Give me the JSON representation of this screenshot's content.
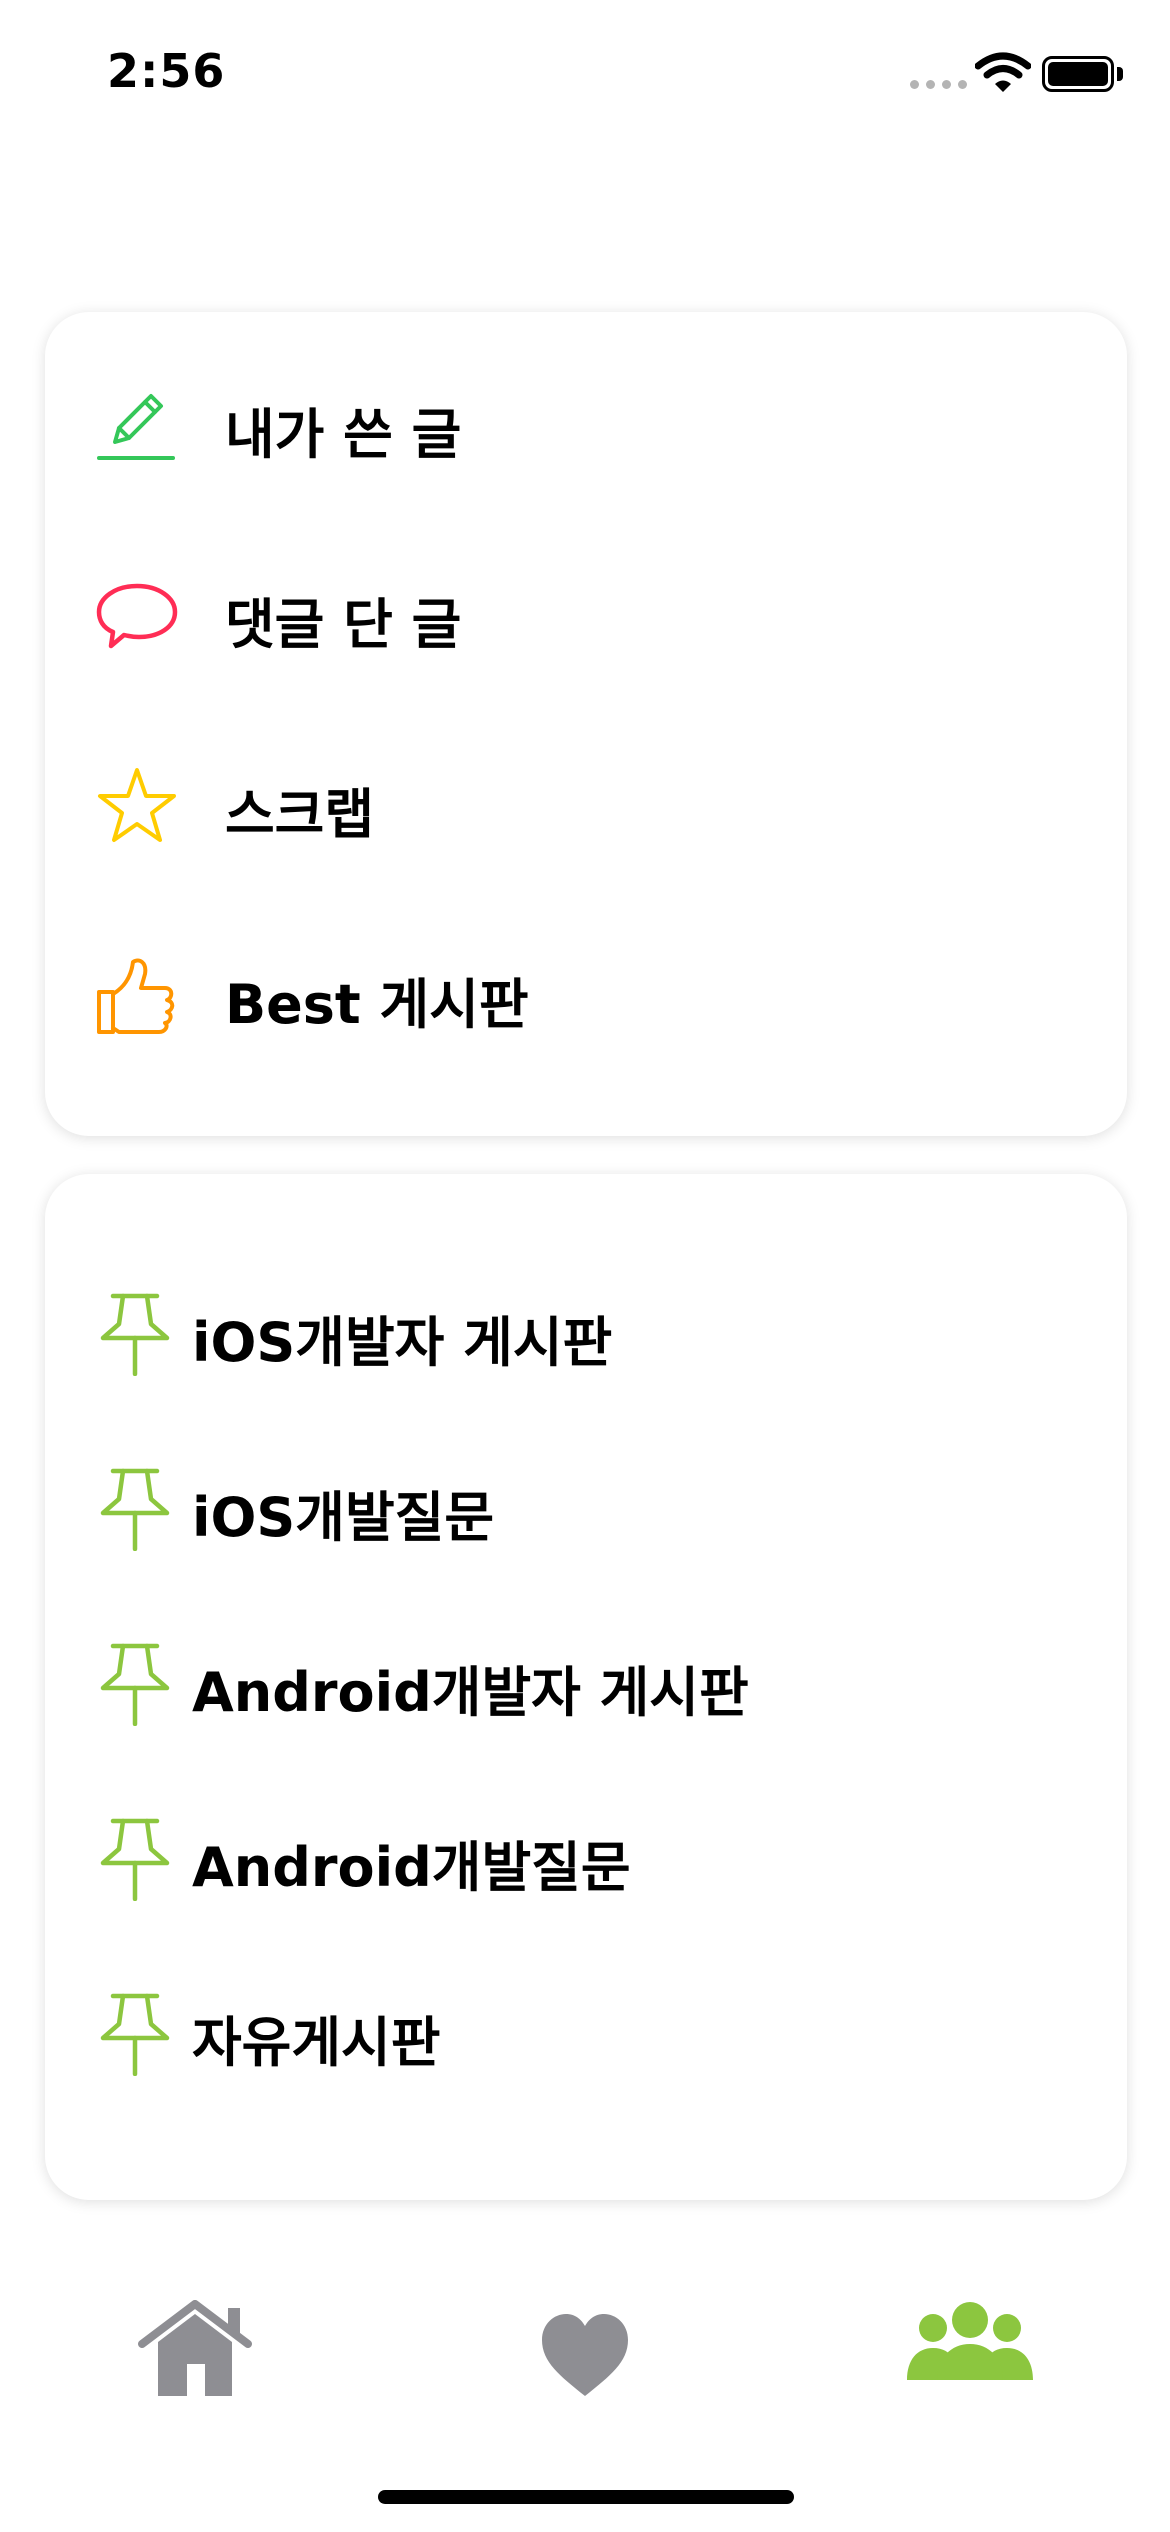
{
  "status_bar": {
    "time": "2:56",
    "battery_level_percent": 100
  },
  "colors": {
    "pencil": "#34c759",
    "comment": "#ff2d55",
    "star": "#ffcc00",
    "thumb": "#ff9500",
    "pin": "#8cc63f",
    "tab_active": "#8cc63f",
    "tab_inactive": "#8e8e93"
  },
  "my_menu": {
    "items": [
      {
        "label": "내가 쓴 글",
        "icon": "pencil-icon"
      },
      {
        "label": "댓글 단 글",
        "icon": "comment-icon"
      },
      {
        "label": "스크랩",
        "icon": "star-icon"
      },
      {
        "label": "Best 게시판",
        "icon": "thumbs-up-icon"
      }
    ]
  },
  "boards": {
    "items": [
      {
        "label": "iOS개발자 게시판",
        "icon": "pin-icon"
      },
      {
        "label": "iOS개발질문",
        "icon": "pin-icon"
      },
      {
        "label": "Android개발자 게시판",
        "icon": "pin-icon"
      },
      {
        "label": "Android개발질문",
        "icon": "pin-icon"
      },
      {
        "label": "자유게시판",
        "icon": "pin-icon"
      }
    ]
  },
  "tab_bar": {
    "tabs": [
      {
        "name": "home",
        "icon": "home-icon",
        "active": false
      },
      {
        "name": "favorites",
        "icon": "heart-icon",
        "active": false
      },
      {
        "name": "community",
        "icon": "people-icon",
        "active": true
      }
    ]
  }
}
